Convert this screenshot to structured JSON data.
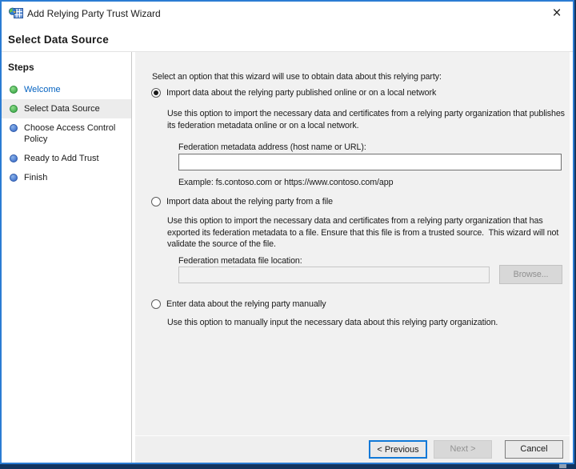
{
  "window": {
    "title": "Add Relying Party Trust Wizard",
    "close_glyph": "×"
  },
  "header": {
    "title": "Select Data Source"
  },
  "sidebar": {
    "heading": "Steps",
    "items": [
      {
        "label": "Welcome",
        "status": "done"
      },
      {
        "label": "Select Data Source",
        "status": "current"
      },
      {
        "label": "Choose Access Control\nPolicy",
        "status": "todo"
      },
      {
        "label": "Ready to Add Trust",
        "status": "todo"
      },
      {
        "label": "Finish",
        "status": "todo"
      }
    ]
  },
  "content": {
    "intro": "Select an option that this wizard will use to obtain data about this relying party:",
    "options": [
      {
        "label": "Import data about the relying party published online or on a local network",
        "selected": true,
        "description": "Use this option to import the necessary data and certificates from a relying party organization that publishes\nits federation metadata online or on a local network.",
        "field_label": "Federation metadata address (host name or URL):",
        "input_value": "",
        "example": "Example: fs.contoso.com or https://www.contoso.com/app"
      },
      {
        "label": "Import data about the relying party from a file",
        "selected": false,
        "description": "Use this option to import the necessary data and certificates from a relying party organization that has\nexported its federation metadata to a file. Ensure that this file is from a trusted source.  This wizard will not\nvalidate the source of the file.",
        "field_label": "Federation metadata file location:",
        "input_value": "",
        "browse_label": "Browse..."
      },
      {
        "label": "Enter data about the relying party manually",
        "selected": false,
        "description": "Use this option to manually input the necessary data about this relying party organization."
      }
    ]
  },
  "footer": {
    "previous_label": "< Previous",
    "next_label": "Next >",
    "cancel_label": "Cancel"
  },
  "colors": {
    "window_border": "#2b7cd3",
    "link_blue": "#0563c1",
    "step_done_green": "#3fae49",
    "step_todo_blue": "#3b6fd0",
    "content_bg": "#f1f1f1",
    "highlight_row": "#ececec"
  }
}
